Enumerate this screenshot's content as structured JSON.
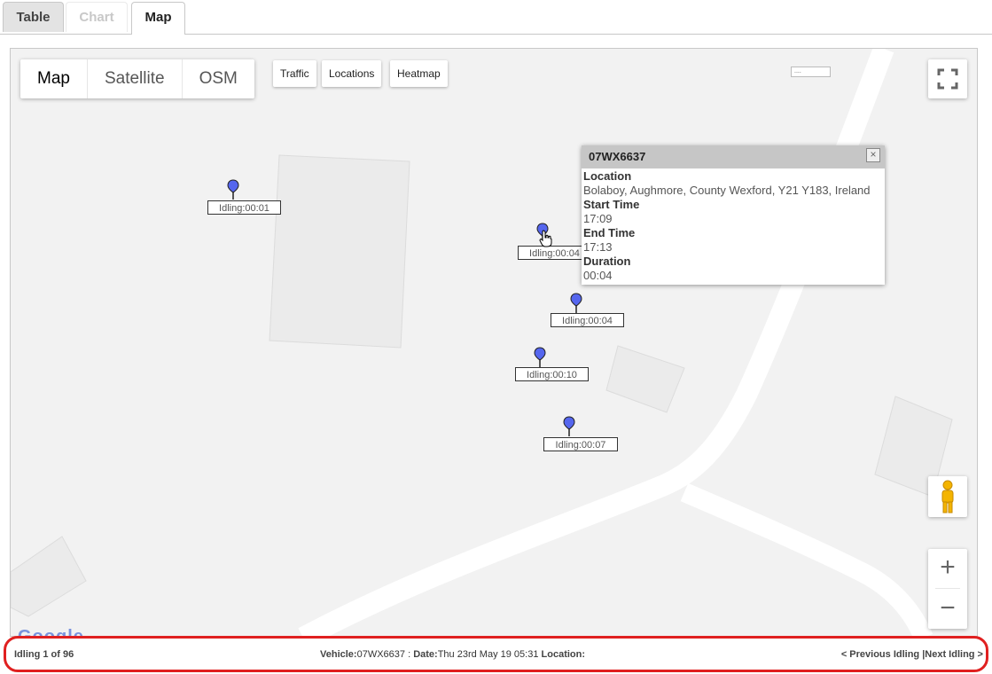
{
  "tabs": [
    {
      "label": "Table"
    },
    {
      "label": "Chart"
    },
    {
      "label": "Map"
    }
  ],
  "map": {
    "map_types": [
      "Map",
      "Satellite",
      "OSM"
    ],
    "controls": {
      "traffic": "Traffic",
      "locations": "Locations",
      "heatmap": "Heatmap"
    },
    "scale_text": "....",
    "marker_labels": [
      "Idling:00:01",
      "Idling:00:04",
      "Idling:00:04",
      "Idling:00:10",
      "Idling:00:07"
    ],
    "marker_color": "#5566ee",
    "provider_logo": "Google"
  },
  "info_window": {
    "title": "07WX6637",
    "location_label": "Location",
    "location_value": "Bolaboy, Aughmore, County Wexford, Y21 Y183, Ireland",
    "start_label": "Start Time",
    "start_value": "17:09",
    "end_label": "End Time",
    "end_value": "17:13",
    "duration_label": "Duration",
    "duration_value": "00:04",
    "close_symbol": "×"
  },
  "status": {
    "count": "Idling 1 of 96",
    "vehicle_label": "Vehicle:",
    "vehicle_value": "07WX6637",
    "separator": " : ",
    "date_label": "Date:",
    "date_value": "Thu 23rd May 19 05:31",
    "location_label": "Location:",
    "location_value": "",
    "prev": "< Previous Idling |",
    "next": "Next Idling >",
    "highlight_color": "#e02020"
  }
}
